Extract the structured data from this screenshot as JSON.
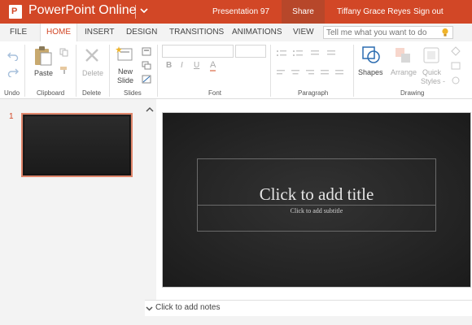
{
  "titlebar": {
    "logo": "P",
    "app_name": "PowerPoint Online",
    "file_name": "Presentation 97",
    "share": "Share",
    "user": "Tiffany Grace Reyes",
    "sign_out": "Sign out",
    "accent": "#d24726"
  },
  "tabs": [
    "FILE",
    "HOME",
    "INSERT",
    "DESIGN",
    "TRANSITIONS",
    "ANIMATIONS",
    "VIEW"
  ],
  "active_tab": "HOME",
  "tell_me": {
    "placeholder": "Tell me what you want to do"
  },
  "ribbon": {
    "groups": {
      "undo": "Undo",
      "clipboard": "Clipboard",
      "delete": "Delete",
      "slides": "Slides",
      "font": "Font",
      "paragraph": "Paragraph",
      "drawing": "Drawing"
    },
    "buttons": {
      "paste": "Paste",
      "delete": "Delete",
      "new_slide_1": "New",
      "new_slide_2": "Slide",
      "shapes": "Shapes",
      "arrange": "Arrange",
      "quick_styles_1": "Quick",
      "quick_styles_2": "Styles -"
    },
    "font_glyphs": {
      "bold": "B",
      "italic": "I",
      "underline": "U",
      "color": "A"
    }
  },
  "slides_panel": {
    "slide_number": "1"
  },
  "slide": {
    "title_placeholder": "Click to add title",
    "subtitle_placeholder": "Click to add subtitle"
  },
  "notes": {
    "placeholder": "Click to add notes"
  }
}
